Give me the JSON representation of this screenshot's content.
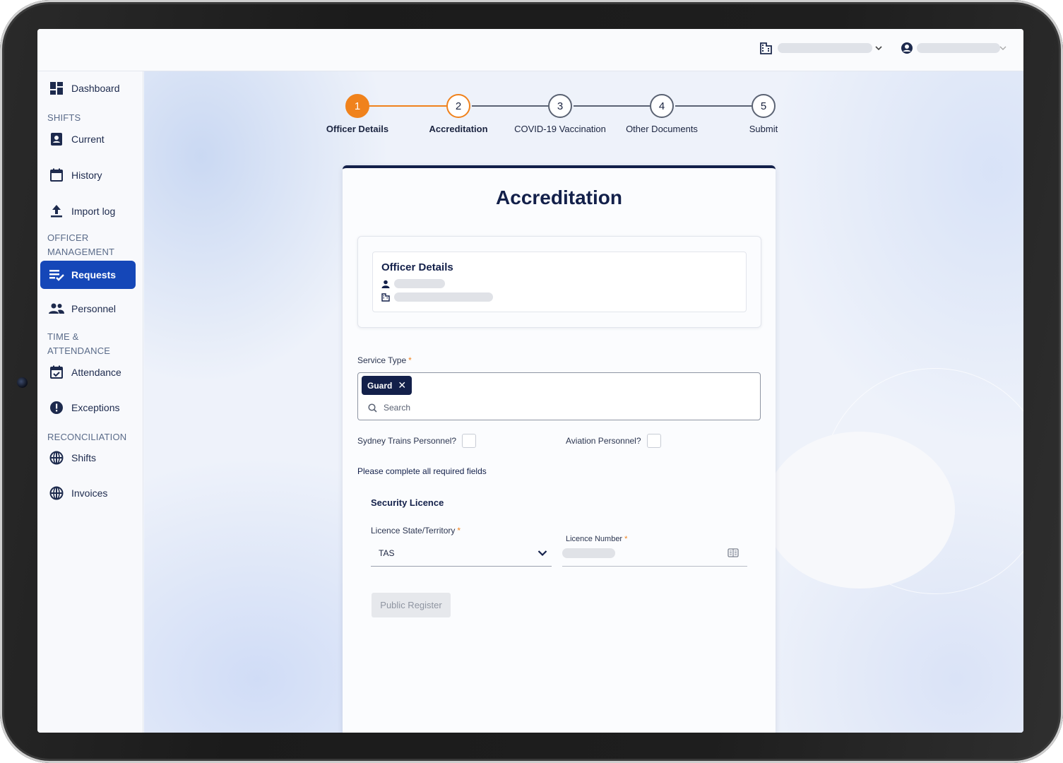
{
  "sidebar": {
    "items": [
      {
        "label": "Dashboard",
        "icon": "dashboard-icon"
      },
      {
        "label": "Current",
        "icon": "badge-icon"
      },
      {
        "label": "History",
        "icon": "calendar-icon"
      },
      {
        "label": "Import log",
        "icon": "upload-icon"
      },
      {
        "label": "Requests",
        "icon": "requests-icon",
        "active": true
      },
      {
        "label": "Personnel",
        "icon": "people-icon"
      },
      {
        "label": "Attendance",
        "icon": "calendar-check-icon"
      },
      {
        "label": "Exceptions",
        "icon": "alert-icon"
      },
      {
        "label": "Shifts",
        "icon": "globe-icon"
      },
      {
        "label": "Invoices",
        "icon": "globe-icon"
      }
    ],
    "sections": {
      "shifts": "SHIFTS",
      "officer_management_1": "OFFICER",
      "officer_management_2": "MANAGEMENT",
      "time_attendance_1": "TIME &",
      "time_attendance_2": "ATTENDANCE",
      "reconciliation": "RECONCILIATION"
    },
    "active_color": "#1547b8"
  },
  "stepper": {
    "steps": [
      {
        "number": "1",
        "label": "Officer Details"
      },
      {
        "number": "2",
        "label": "Accreditation"
      },
      {
        "number": "3",
        "label": "COVID-19 Vaccination"
      },
      {
        "number": "4",
        "label": "Other Documents"
      },
      {
        "number": "5",
        "label": "Submit"
      }
    ],
    "accent_color": "#f0821c"
  },
  "form": {
    "title": "Accreditation",
    "officer_card_title": "Officer Details",
    "service_type_label": "Service Type",
    "required_mark": "*",
    "selected_chip": "Guard",
    "search_placeholder": "Search",
    "sydney_trains_label": "Sydney Trains Personnel?",
    "aviation_label": "Aviation Personnel?",
    "warning": "Please complete all required fields",
    "section_title": "Security Licence",
    "licence_state_label": "Licence State/Territory",
    "licence_state_value": "TAS",
    "licence_number_label": "Licence Number",
    "public_register_button": "Public Register"
  },
  "colors": {
    "navy": "#13204a",
    "accent": "#f0821c"
  }
}
